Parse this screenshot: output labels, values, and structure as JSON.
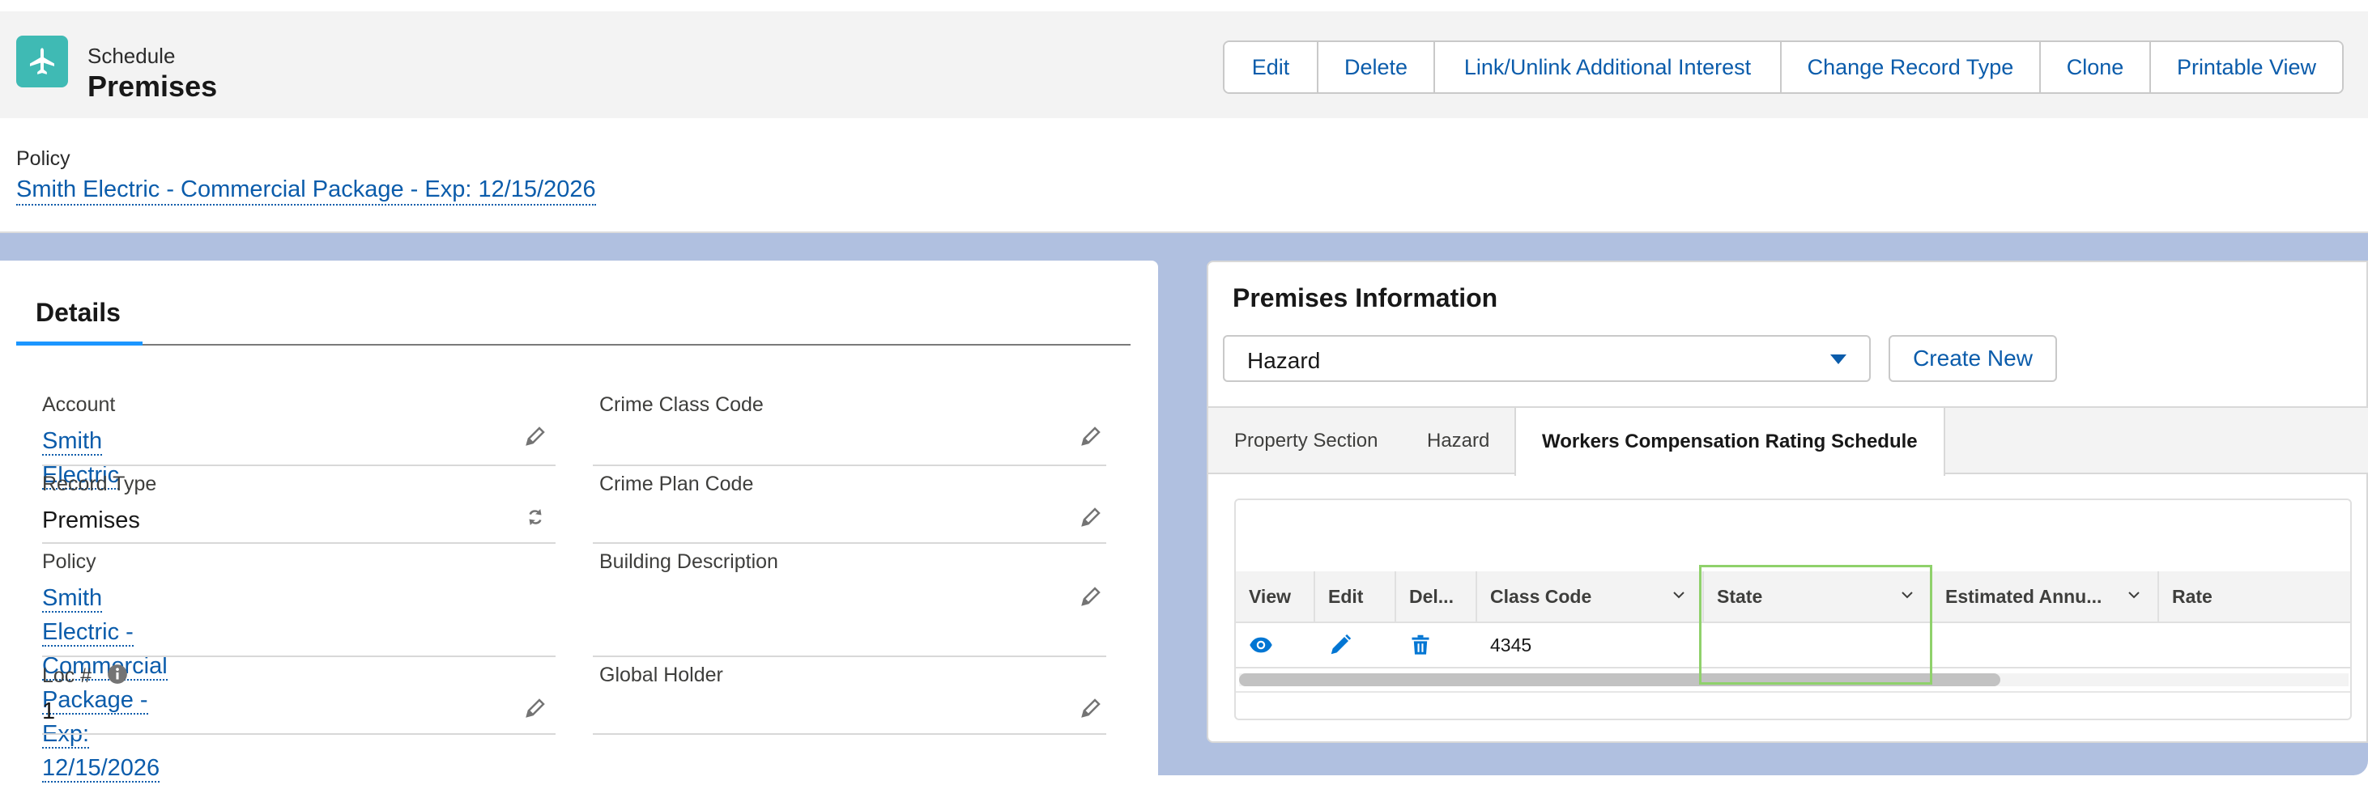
{
  "header": {
    "object_label": "Schedule",
    "record_title": "Premises",
    "icon": "airplane-icon",
    "actions": [
      "Edit",
      "Delete",
      "Link/Unlink Additional Interest",
      "Change Record Type",
      "Clone",
      "Printable View"
    ]
  },
  "policy_bar": {
    "label": "Policy",
    "link": "Smith Electric - Commercial Package - Exp: 12/15/2026"
  },
  "details": {
    "tab_label": "Details",
    "left_fields": [
      {
        "label": "Account",
        "value": "Smith Electric"
      },
      {
        "label": "Record Type",
        "value": "Premises"
      },
      {
        "label": "Policy",
        "value_line1": "Smith Electric - Commercial Package - Exp:",
        "value_line2": "12/15/2026"
      },
      {
        "label": "Loc #",
        "value": "1"
      }
    ],
    "right_fields": [
      {
        "label": "Crime Class Code",
        "value": ""
      },
      {
        "label": "Crime Plan Code",
        "value": ""
      },
      {
        "label": "Building Description",
        "value": ""
      },
      {
        "label": "Global Holder",
        "value": ""
      }
    ]
  },
  "premises_info": {
    "title": "Premises Information",
    "select_value": "Hazard",
    "create_button": "Create New",
    "tabs": [
      "Property Section",
      "Hazard",
      "Workers Compensation Rating Schedule"
    ],
    "active_tab": "Workers Compensation Rating Schedule",
    "table": {
      "columns": [
        "View",
        "Edit",
        "Del...",
        "Class Code",
        "State",
        "Estimated Annu...",
        "Rate"
      ],
      "rows": [
        {
          "class_code": "4345",
          "state": "",
          "estimated_annual": "",
          "rate": ""
        }
      ]
    }
  },
  "colors": {
    "brand_blue": "#0b5cab",
    "app_icon_teal": "#3fbab4",
    "highlight_green": "#8fd16b",
    "page_background": "#b0c0e0"
  }
}
